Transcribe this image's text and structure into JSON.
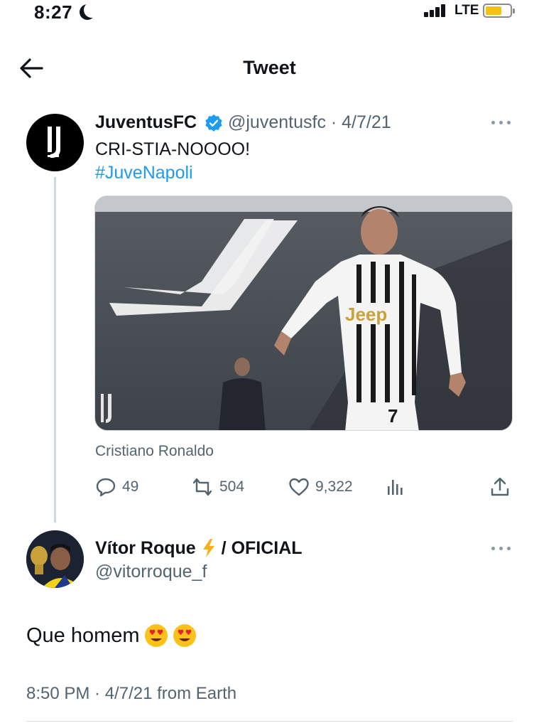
{
  "status_bar": {
    "time": "8:27",
    "network": "LTE",
    "battery_level": 0.6
  },
  "header": {
    "title": "Tweet"
  },
  "quoted_tweet": {
    "author_name": "JuventusFC",
    "handle_date": "@juventusfc · 4/7/21",
    "text": "CRI-STIA-NOOOO!",
    "hashtag": "#JuveNapoli",
    "media_caption": "Cristiano Ronaldo",
    "media_jersey_text": "Jeep",
    "media_jersey_number": "7",
    "stats": {
      "replies": "49",
      "retweets": "504",
      "likes": "9,322"
    }
  },
  "reply_tweet": {
    "author_name": "Vítor Roque",
    "author_suffix": "/ OFICIAL",
    "handle": "@vitorroque_f",
    "text": "Que homem",
    "footer": "8:50 PM · 4/7/21 from Earth"
  },
  "colors": {
    "accent": "#1d9bf0",
    "muted": "#536471",
    "verified": "#1d9bf0"
  }
}
